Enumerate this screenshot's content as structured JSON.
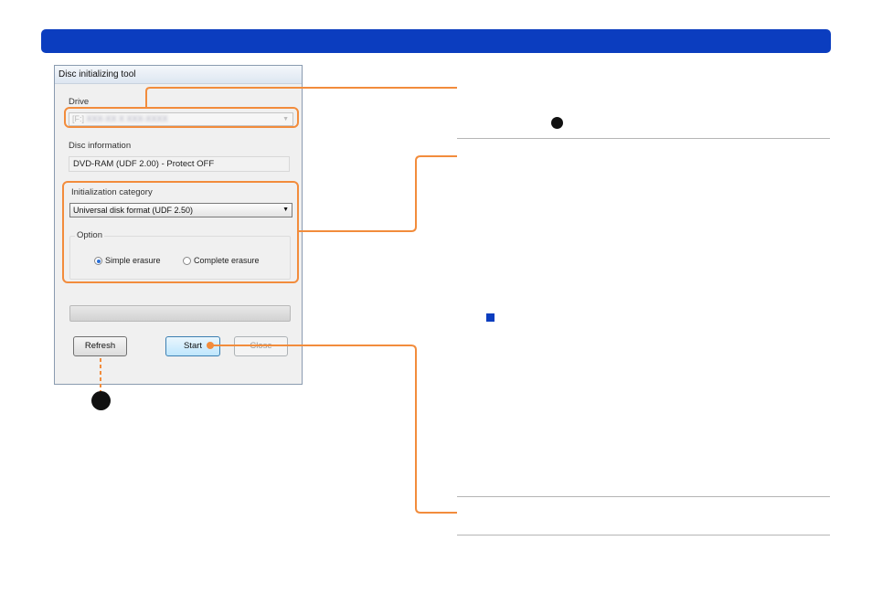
{
  "dialog": {
    "title": "Disc initializing tool",
    "drive": {
      "label": "Drive",
      "value_prefix": "[F:]",
      "value_blurred": "XXX-XX X XXX-XXXX"
    },
    "disc_information": {
      "label": "Disc information",
      "value": "DVD-RAM (UDF 2.00) - Protect OFF"
    },
    "initialization_category": {
      "label": "Initialization category",
      "value": "Universal disk format (UDF 2.50)"
    },
    "option": {
      "label": "Option",
      "choices": [
        {
          "label": "Simple erasure",
          "selected": true
        },
        {
          "label": "Complete erasure",
          "selected": false
        }
      ]
    },
    "progress": {
      "value": 0
    },
    "buttons": {
      "refresh": "Refresh",
      "start": "Start",
      "close": "Close"
    }
  },
  "colors": {
    "header_bar": "#0b3dbf",
    "callout": "#f28c3c",
    "square_icon": "#0b3dbf"
  }
}
